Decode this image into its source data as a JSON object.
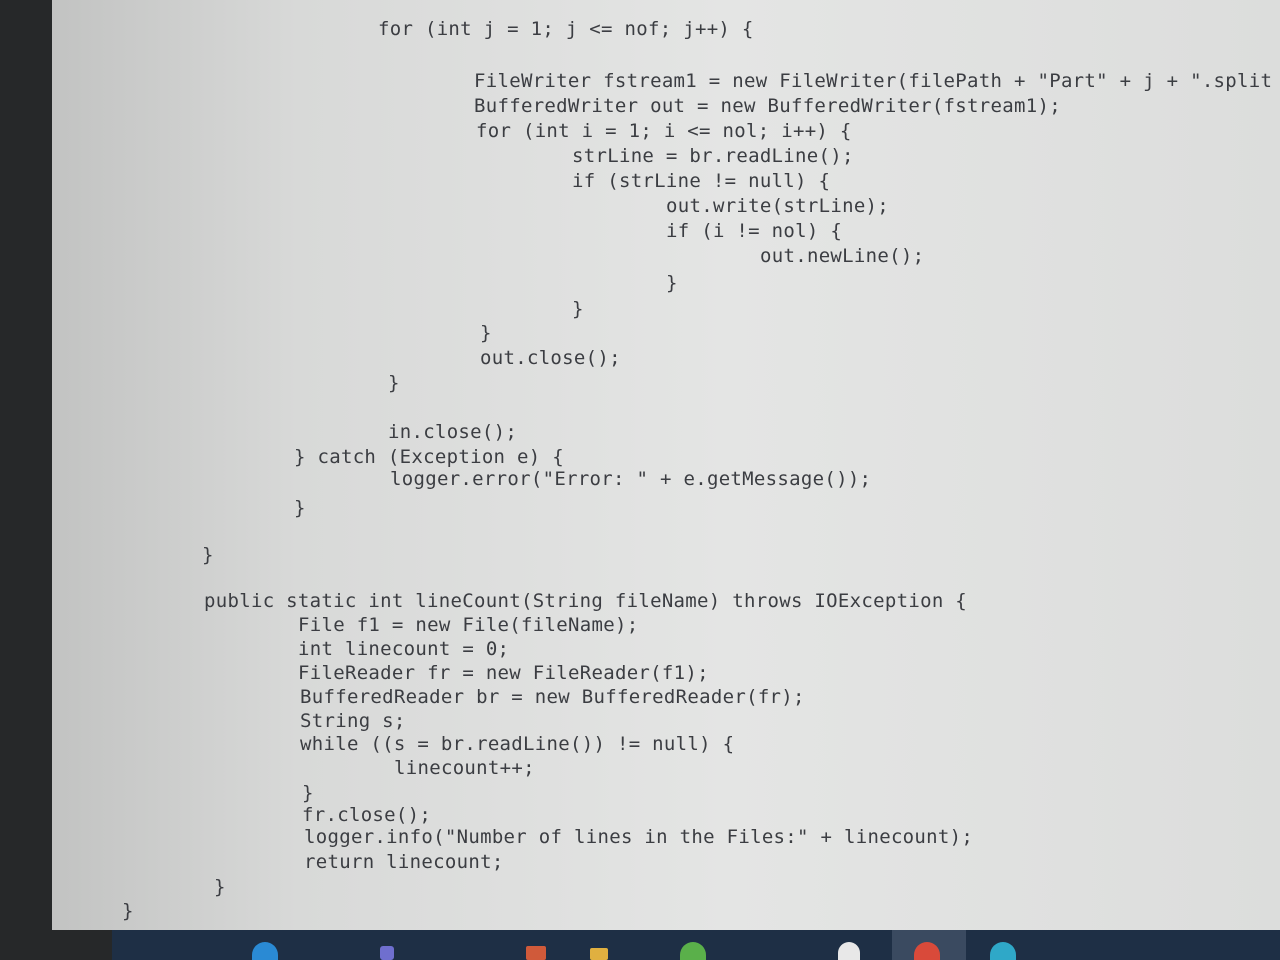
{
  "code_editor": {
    "lines": [
      "for (int j = 1; j <= nof; j++) {",
      "FileWriter fstream1 = new FileWriter(filePath + \"Part\" + j + \".split",
      "BufferedWriter out = new BufferedWriter(fstream1);",
      "for (int i = 1; i <= nol; i++) {",
      "strLine = br.readLine();",
      "if (strLine != null) {",
      "out.write(strLine);",
      "if (i != nol) {",
      "out.newLine();",
      "}",
      "}",
      "}",
      "out.close();",
      "}",
      "in.close();",
      "} catch (Exception e) {",
      "logger.error(\"Error: \" + e.getMessage());",
      "}",
      "}",
      "public static int lineCount(String fileName) throws IOException {",
      "File f1 = new File(fileName);",
      "int linecount = 0;",
      "FileReader fr = new FileReader(f1);",
      "BufferedReader br = new BufferedReader(fr);",
      "String s;",
      "while ((s = br.readLine()) != null) {",
      "linecount++;",
      "}",
      "fr.close();",
      "logger.info(\"Number of lines in the Files:\" + linecount);",
      "return linecount;",
      "}",
      "}"
    ]
  },
  "taskbar": {
    "icons": [
      "edge-icon",
      "teams-icon",
      "mail-icon",
      "file-explorer-icon",
      "settings-icon",
      "photos-icon",
      "chrome-icon",
      "edge-browser-icon"
    ],
    "colors": {
      "background": "#1e2f45",
      "icon1": "#2a8ad4",
      "icon2": "#6f6fcf",
      "icon3": "#d05a3a",
      "icon4": "#e0b040",
      "icon5": "#5ab04a",
      "icon6": "#e8e8e8",
      "icon7": "#d94a3a",
      "icon8": "#2fa8c8"
    }
  }
}
